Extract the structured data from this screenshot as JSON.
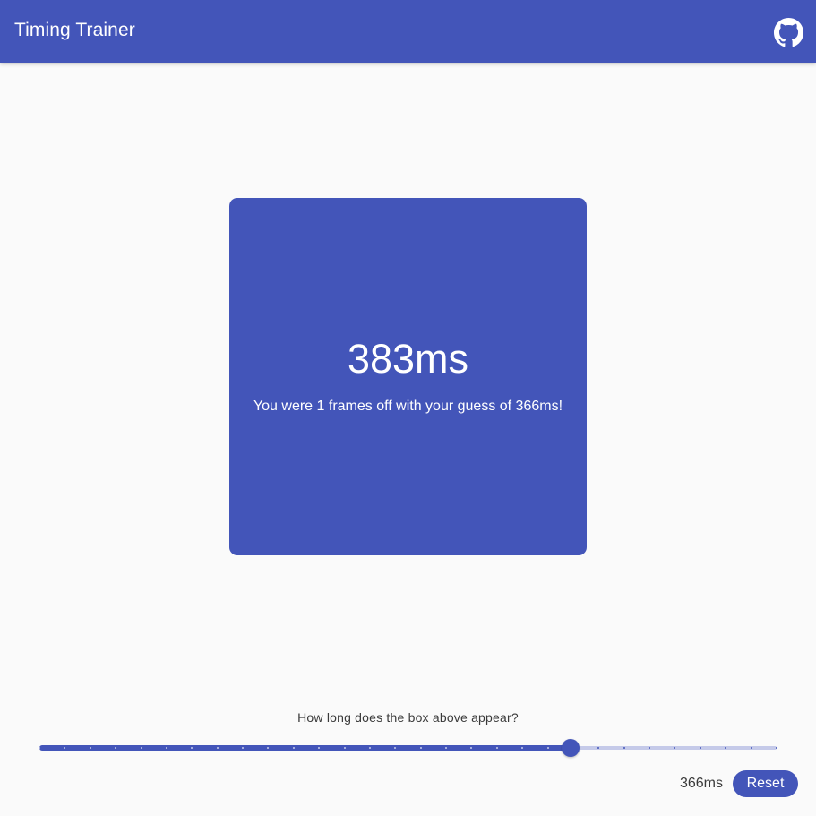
{
  "header": {
    "title": "Timing Trainer",
    "github_icon": "github-icon"
  },
  "box": {
    "time": "383ms",
    "message": "You were 1 frames off with your guess of 366ms!"
  },
  "guess": {
    "question": "How long does the box above appear?",
    "slider_fraction": 0.72,
    "slider_steps": 29,
    "value_label": "366ms",
    "reset_label": "Reset"
  },
  "colors": {
    "primary": "#4355b9",
    "track_inactive": "#c5cae9",
    "background": "#fafafa"
  }
}
